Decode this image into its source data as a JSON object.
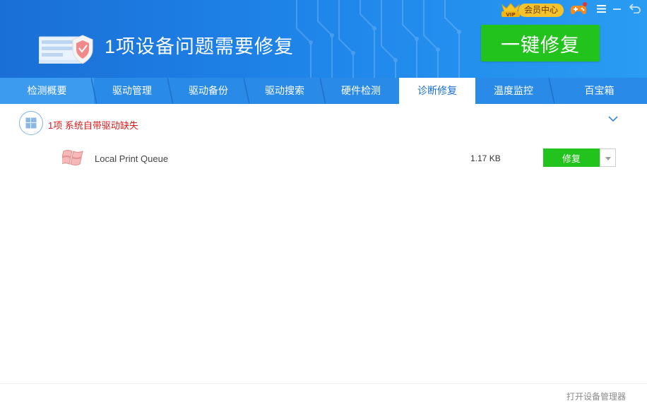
{
  "header": {
    "headline": "1项设备问题需要修复",
    "fix_all_label": "一键修复",
    "vip_label": "会员中心",
    "vip_badge_text": "VIP",
    "icons": [
      "device-shield-icon",
      "vip-crown-icon",
      "game-controller-icon",
      "menu-icon",
      "minimize-icon",
      "back-icon"
    ]
  },
  "tabs": [
    {
      "label": "检测概要"
    },
    {
      "label": "驱动管理"
    },
    {
      "label": "驱动备份"
    },
    {
      "label": "驱动搜索"
    },
    {
      "label": "硬件检测"
    },
    {
      "label": "诊断修复",
      "active": true
    },
    {
      "label": "温度监控"
    },
    {
      "label": "百宝箱"
    }
  ],
  "category": {
    "label": "1项 系统自带驱动缺失",
    "icon": "windows-icon",
    "expanded": true
  },
  "drivers": [
    {
      "name": "Local Print Queue",
      "size": "1.17 KB",
      "action": "修复",
      "icon": "windows-logo-icon"
    }
  ],
  "footer": {
    "link": "打开设备管理器"
  },
  "colors": {
    "header_blue": "#1f86ea",
    "tab_bar": "#2a8ae8",
    "green_button": "#22c31c",
    "category_red": "#d91b1b"
  }
}
